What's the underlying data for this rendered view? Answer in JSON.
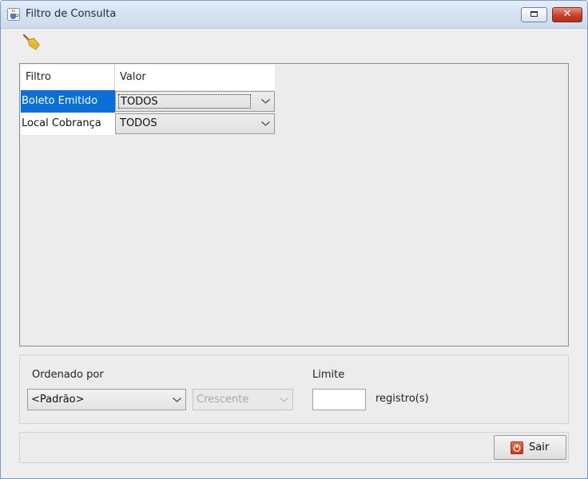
{
  "window": {
    "title": "Filtro de Consulta",
    "close_symbol": "✕"
  },
  "icons": {
    "app": "java-cup-icon",
    "clear": "broom-icon",
    "exit": "power-icon",
    "dropdown": "chevron-down-icon"
  },
  "filter_table": {
    "headers": {
      "filter": "Filtro",
      "value": "Valor"
    },
    "rows": [
      {
        "filter": "Boleto Emitido",
        "value": "TODOS",
        "selected": true
      },
      {
        "filter": "Local Cobrança",
        "value": "TODOS",
        "selected": false
      }
    ]
  },
  "ordering": {
    "label": "Ordenado por",
    "field_value": "<Padrão>",
    "direction_value": "Crescente",
    "limit_label": "Limite",
    "limit_value": "",
    "limit_suffix": "registro(s)"
  },
  "footer": {
    "exit_label": "Sair"
  },
  "colors": {
    "selection": "#0a6fd6",
    "close_button": "#c6402a",
    "exit_icon": "#e0502f"
  }
}
